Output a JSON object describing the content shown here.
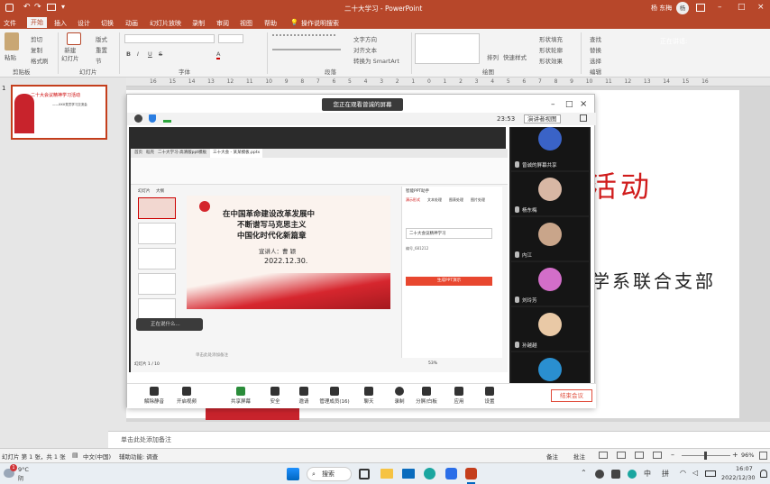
{
  "window": {
    "title": "二十大学习 - PowerPoint",
    "user": "杨 东梅",
    "avatar_text": "杨"
  },
  "menu": {
    "file": "文件",
    "home": "开始",
    "insert": "插入",
    "design": "设计",
    "transitions": "切换",
    "animations": "动画",
    "slideshow": "幻灯片放映",
    "record": "录制",
    "review": "审阅",
    "view": "视图",
    "help": "帮助",
    "search": "操作说明搜索",
    "speaking": "正在讲话:"
  },
  "ribbon": {
    "paste": "粘贴",
    "cut": "剪切",
    "copy": "复制",
    "format_painter": "格式刷",
    "clipboard": "剪贴板",
    "new_slide": "新建\n幻灯片",
    "layout": "版式",
    "reset": "重置",
    "section": "节",
    "slides": "幻灯片",
    "font": "字体",
    "paragraph": "段落",
    "text_direction": "文字方向",
    "align_text": "对齐文本",
    "smartart": "转换为 SmartArt",
    "arrange": "排列",
    "quick_styles": "快速样式",
    "shape_fill": "形状填充",
    "shape_outline": "形状轮廓",
    "shape_effects": "形状效果",
    "drawing": "绘图",
    "find": "查找",
    "replace": "替换",
    "select": "选择",
    "editing": "编辑"
  },
  "ruler": {
    "ticks": [
      "16",
      "15",
      "14",
      "13",
      "12",
      "11",
      "10",
      "9",
      "8",
      "7",
      "6",
      "5",
      "4",
      "3",
      "2",
      "1",
      "0",
      "1",
      "2",
      "3",
      "4",
      "5",
      "6",
      "7",
      "8",
      "9",
      "10",
      "11",
      "12",
      "13",
      "14",
      "15",
      "16"
    ]
  },
  "thumbnail": {
    "number": "1",
    "title": "二十大会议精神学习活动",
    "subtitle": "——XXX党员学习交流会"
  },
  "slide": {
    "title_frag": "活动",
    "subtitle_frag": "学系联合支部"
  },
  "meeting": {
    "banner": "您正在观看曾诚的屏幕",
    "time": "23:53",
    "view_btn": "演讲者视图",
    "participants": [
      {
        "name": "曾诚的屏幕共享"
      },
      {
        "name": "杨东梅"
      },
      {
        "name": "内江"
      },
      {
        "name": "刘玲芳"
      },
      {
        "name": "孙越越"
      },
      {
        "name": "赵刚"
      }
    ],
    "toolbar": [
      {
        "label": "解除静音"
      },
      {
        "label": "开启视频"
      },
      {
        "label": "共享屏幕"
      },
      {
        "label": "安全"
      },
      {
        "label": "邀请"
      },
      {
        "label": "管理成员(16)"
      },
      {
        "label": "聊天"
      },
      {
        "label": "录制"
      },
      {
        "label": "分屏/白板"
      },
      {
        "label": "应用"
      },
      {
        "label": "设置"
      }
    ],
    "end": "结束会议",
    "caption": "正在说什么..."
  },
  "inner": {
    "tabs": [
      "首页",
      "稻壳",
      "二十大学习-高清版ppt模板",
      "三十大会 - 某某模板.pptx"
    ],
    "slide_title1": "在中国革命建设改革发展中",
    "slide_title2": "不断谱写马克思主义",
    "slide_title3": "中国化时代化新篇章",
    "speaker": "宣讲人：曹 颖",
    "date": "2022.12.30.",
    "panel_tab1": "幻灯片",
    "panel_tab2": "大纲",
    "right_title": "智能PPT助手",
    "right_tab1": "演示形式",
    "right_tab2": "文本处理",
    "right_tab3": "图表处理",
    "right_tab4": "图片处理",
    "right_input": "二十大会议精神学习",
    "right_note": "编号_681212",
    "right_btn": "生成PPT演示",
    "slide_count": "幻灯片 1 / 10",
    "zoom_val": "53%",
    "notes_hint": "单击此处添加备注"
  },
  "notes": {
    "placeholder": "单击此处添加备注"
  },
  "status": {
    "slide": "幻灯片 第 1 张，共 1 张",
    "lang": "中文(中国)",
    "accessibility": "辅助功能: 调查",
    "notes_btn": "备注",
    "comments": "批注",
    "zoom": "96%"
  },
  "taskbar": {
    "weather_temp": "9°C",
    "weather_desc": "阴",
    "search": "搜索",
    "ime1": "中",
    "ime2": "拼",
    "time": "16:07",
    "date": "2022/12/30",
    "badge": "1"
  }
}
